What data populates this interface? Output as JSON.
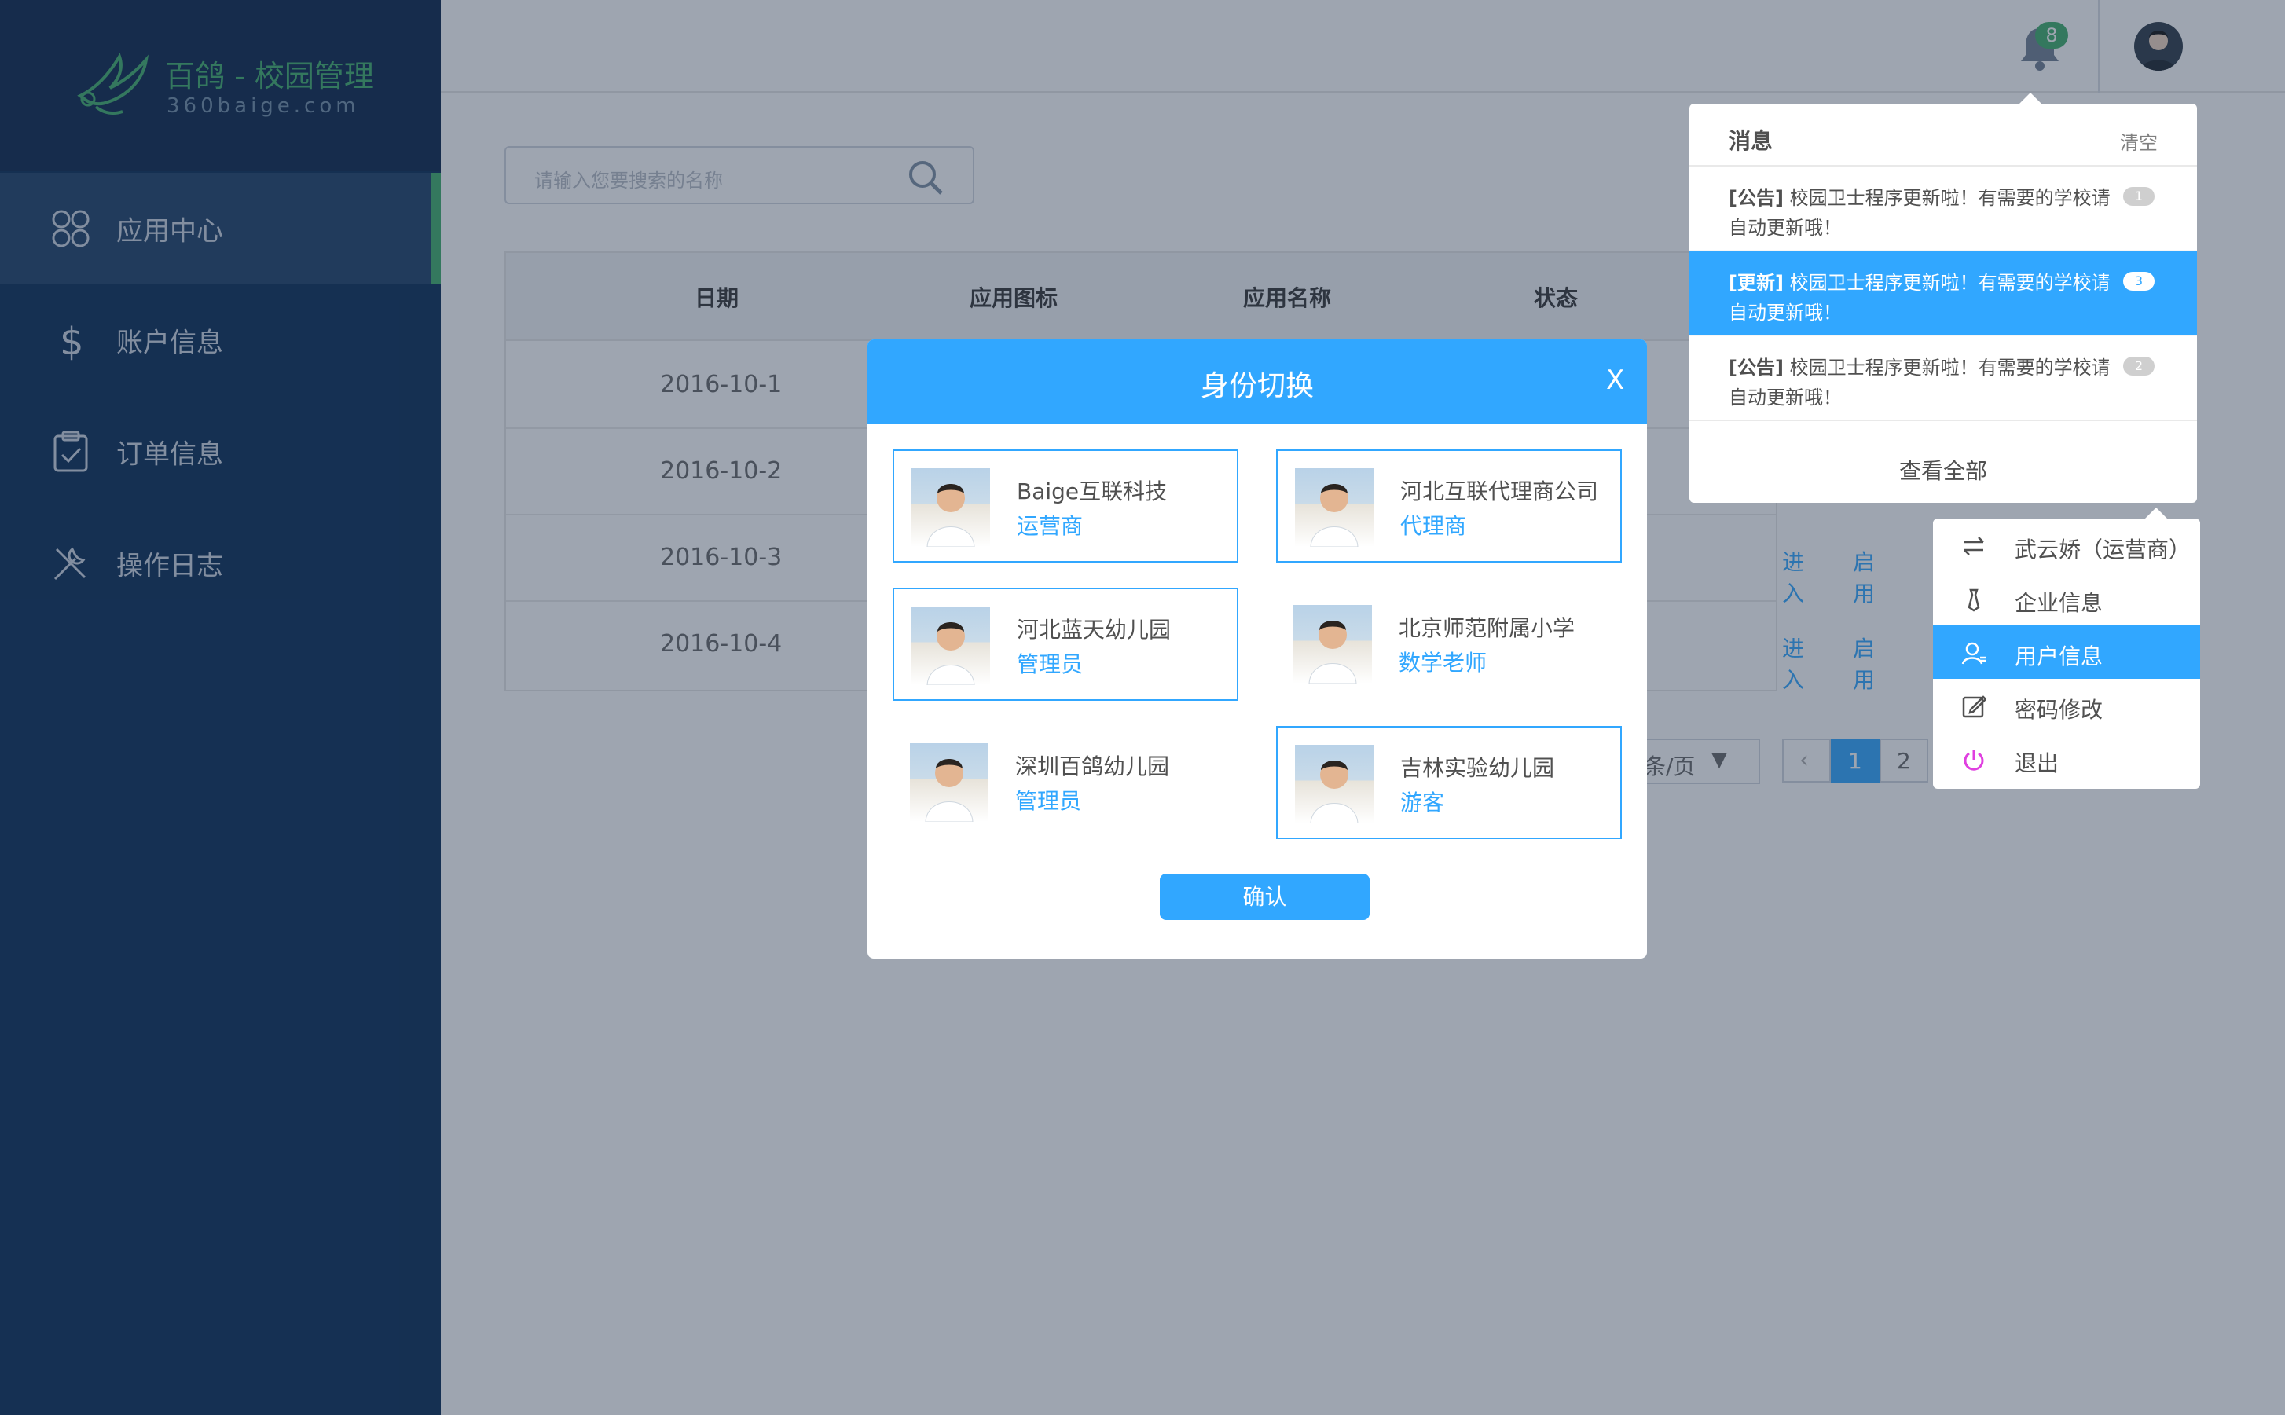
{
  "app": {
    "title": "百鸽 - 校园管理",
    "subtitle": "360baige.com"
  },
  "sidebar": {
    "items": [
      {
        "label": "应用中心",
        "icon": "apps-icon",
        "active": true
      },
      {
        "label": "账户信息",
        "icon": "dollar-icon"
      },
      {
        "label": "订单信息",
        "icon": "clipboard-icon"
      },
      {
        "label": "操作日志",
        "icon": "tools-icon"
      }
    ]
  },
  "header": {
    "bell_count": "8",
    "bell_icon": "bell-icon",
    "avatar_icon": "user-avatar"
  },
  "search": {
    "placeholder": "请输入您要搜索的名称",
    "icon": "search-icon"
  },
  "table": {
    "headers": [
      "日期",
      "应用图标",
      "应用名称",
      "状态"
    ],
    "rows": [
      {
        "date": "2016-10-1"
      },
      {
        "date": "2016-10-2"
      },
      {
        "date": "2016-10-3",
        "actions": [
          "进入",
          "启用"
        ]
      },
      {
        "date": "2016-10-4",
        "actions": [
          "进入",
          "启用"
        ]
      }
    ]
  },
  "pager": {
    "page_size_label": "条/页",
    "pages": [
      "1",
      "2"
    ],
    "current": "1"
  },
  "modal": {
    "title": "身份切换",
    "close": "X",
    "cards": [
      {
        "name": "Baige互联科技",
        "role": "运营商",
        "selected": true
      },
      {
        "name": "河北互联代理商公司",
        "role": "代理商",
        "selected": true
      },
      {
        "name": "河北蓝天幼儿园",
        "role": "管理员",
        "selected": true
      },
      {
        "name": "北京师范附属小学",
        "role": "数学老师",
        "selected": false
      },
      {
        "name": "深圳百鸽幼儿园",
        "role": "管理员",
        "selected": false
      },
      {
        "name": "吉林实验幼儿园",
        "role": "游客",
        "selected": true
      }
    ],
    "confirm": "确认"
  },
  "notifications": {
    "title": "消息",
    "clear": "清空",
    "items": [
      {
        "tag": "[公告]",
        "text": "校园卫士程序更新啦！有需要的学校请",
        "text2": "自动更新哦！",
        "count": "1",
        "active": false
      },
      {
        "tag": "[更新]",
        "text": "校园卫士程序更新啦！有需要的学校请",
        "text2": "自动更新哦！",
        "count": "3",
        "active": true
      },
      {
        "tag": "[公告]",
        "text": "校园卫士程序更新啦！有需要的学校请",
        "text2": "自动更新哦！",
        "count": "2",
        "active": false
      }
    ],
    "view_all": "查看全部"
  },
  "user_menu": {
    "items": [
      {
        "label": "武云娇（运营商）",
        "icon": "switch-icon"
      },
      {
        "label": "企业信息",
        "icon": "tie-icon"
      },
      {
        "label": "用户信息",
        "icon": "user-icon",
        "active": true
      },
      {
        "label": "密码修改",
        "icon": "edit-icon"
      },
      {
        "label": "退出",
        "icon": "power-icon"
      }
    ]
  },
  "colors": {
    "primary": "#31a7ff",
    "text": "#505050",
    "muted": "#808080",
    "divider": "#e9e9e9",
    "accent_green": "#3fae6b",
    "sidebar": "#062a55"
  }
}
